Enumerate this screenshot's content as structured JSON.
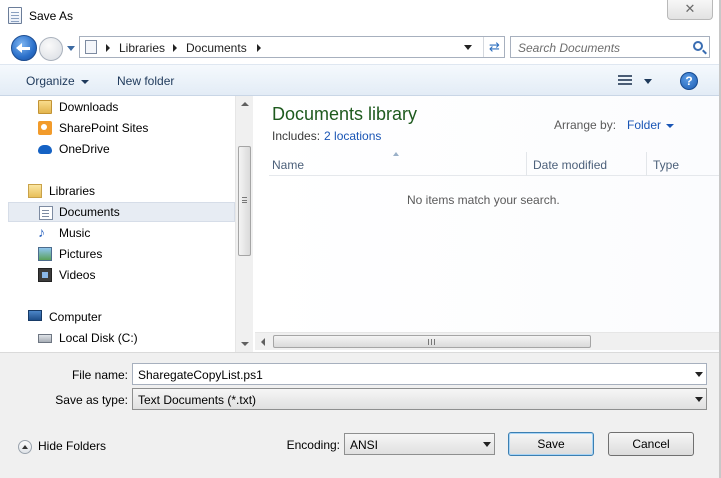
{
  "window": {
    "title": "Save As",
    "close_symbol": "✕"
  },
  "address": {
    "crumbs": [
      "Libraries",
      "Documents"
    ],
    "refresh_symbol": "⇄",
    "search_placeholder": "Search Documents"
  },
  "toolbar": {
    "organize": "Organize",
    "new_folder": "New folder",
    "help": "?"
  },
  "nav": {
    "items": [
      {
        "label": "Downloads",
        "icon": "downloads-icon"
      },
      {
        "label": "SharePoint Sites",
        "icon": "sharepoint-icon"
      },
      {
        "label": "OneDrive",
        "icon": "onedrive-icon"
      },
      {
        "label": "Libraries",
        "icon": "libraries-icon"
      },
      {
        "label": "Documents",
        "icon": "documents-icon",
        "selected": true
      },
      {
        "label": "Music",
        "icon": "music-icon"
      },
      {
        "label": "Pictures",
        "icon": "pictures-icon"
      },
      {
        "label": "Videos",
        "icon": "videos-icon"
      },
      {
        "label": "Computer",
        "icon": "computer-icon"
      },
      {
        "label": "Local Disk (C:)",
        "icon": "disk-icon"
      }
    ]
  },
  "content": {
    "title": "Documents library",
    "includes_label": "Includes:",
    "includes_link": "2 locations",
    "arrange_label": "Arrange by:",
    "arrange_value": "Folder",
    "columns": [
      "Name",
      "Date modified",
      "Type"
    ],
    "empty_message": "No items match your search."
  },
  "form": {
    "file_name_label": "File name:",
    "file_name_value": "SharegateCopyList.ps1",
    "save_type_label": "Save as type:",
    "save_type_value": "Text Documents (*.txt)",
    "encoding_label": "Encoding:",
    "encoding_value": "ANSI",
    "hide_folders": "Hide Folders",
    "save": "Save",
    "cancel": "Cancel"
  },
  "colors": {
    "accent": "#1a55b5",
    "library_title": "#1e5a1e",
    "toolbar_text": "#1e395b"
  }
}
